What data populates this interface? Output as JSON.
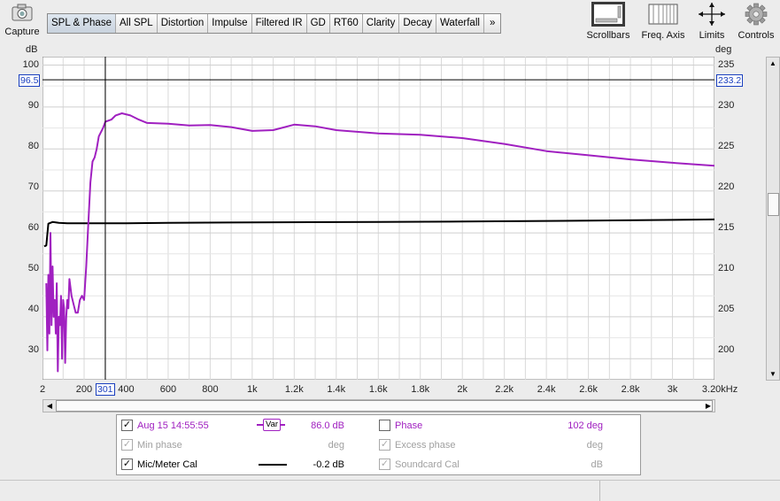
{
  "toolbar": {
    "capture_label": "Capture",
    "tabs": [
      "SPL & Phase",
      "All SPL",
      "Distortion",
      "Impulse",
      "Filtered IR",
      "GD",
      "RT60",
      "Clarity",
      "Decay",
      "Waterfall",
      "»"
    ],
    "active_tab": "SPL & Phase",
    "right_buttons": [
      {
        "label": "Scrollbars",
        "icon": "scrollbars-icon"
      },
      {
        "label": "Freq. Axis",
        "icon": "freq-axis-icon"
      },
      {
        "label": "Limits",
        "icon": "limits-icon"
      },
      {
        "label": "Controls",
        "icon": "gear-icon"
      }
    ]
  },
  "graph": {
    "left_unit": "dB",
    "right_unit": "deg",
    "left_ticks": [
      "100",
      "90",
      "80",
      "70",
      "60",
      "50",
      "40",
      "30"
    ],
    "right_ticks": [
      "235",
      "230",
      "225",
      "220",
      "215",
      "210",
      "205",
      "200"
    ],
    "x_ticks": [
      "2",
      "200",
      "400",
      "600",
      "800",
      "1k",
      "1.2k",
      "1.4k",
      "1.6k",
      "1.8k",
      "2k",
      "2.2k",
      "2.4k",
      "2.6k",
      "2.8k",
      "3k",
      "3.20kHz"
    ],
    "cursor": {
      "left_value": "96.5",
      "right_value": "233.2",
      "x_value": "301"
    }
  },
  "chart_data": {
    "type": "line",
    "x_unit": "Hz",
    "xlim": [
      2,
      3200
    ],
    "ylim_left": [
      25,
      102
    ],
    "ylim_right": [
      195,
      237
    ],
    "grid": true,
    "series": [
      {
        "name": "Aug 15 14:55:55",
        "color": "#a020c0",
        "axis": "left",
        "points": [
          [
            20,
            48
          ],
          [
            25,
            32
          ],
          [
            30,
            50
          ],
          [
            35,
            36
          ],
          [
            40,
            60
          ],
          [
            45,
            38
          ],
          [
            50,
            52
          ],
          [
            55,
            40
          ],
          [
            60,
            44
          ],
          [
            65,
            36
          ],
          [
            70,
            48
          ],
          [
            75,
            27
          ],
          [
            80,
            40
          ],
          [
            85,
            38
          ],
          [
            90,
            45
          ],
          [
            95,
            30
          ],
          [
            100,
            44
          ],
          [
            105,
            42
          ],
          [
            110,
            29
          ],
          [
            115,
            40
          ],
          [
            120,
            44
          ],
          [
            125,
            42
          ],
          [
            130,
            49
          ],
          [
            140,
            45
          ],
          [
            150,
            43
          ],
          [
            160,
            41
          ],
          [
            170,
            41
          ],
          [
            180,
            44
          ],
          [
            190,
            45
          ],
          [
            200,
            44
          ],
          [
            210,
            52
          ],
          [
            220,
            62
          ],
          [
            230,
            72
          ],
          [
            240,
            77
          ],
          [
            250,
            78
          ],
          [
            260,
            80
          ],
          [
            270,
            83
          ],
          [
            280,
            84
          ],
          [
            290,
            85
          ],
          [
            301,
            86.5
          ],
          [
            330,
            87
          ],
          [
            350,
            88
          ],
          [
            380,
            88.5
          ],
          [
            420,
            88
          ],
          [
            460,
            87
          ],
          [
            500,
            86.2
          ],
          [
            600,
            86
          ],
          [
            700,
            85.6
          ],
          [
            800,
            85.7
          ],
          [
            900,
            85.2
          ],
          [
            1000,
            84.3
          ],
          [
            1100,
            84.5
          ],
          [
            1200,
            85.8
          ],
          [
            1300,
            85.4
          ],
          [
            1400,
            84.5
          ],
          [
            1600,
            83.7
          ],
          [
            1800,
            83.4
          ],
          [
            2000,
            82.6
          ],
          [
            2200,
            81.2
          ],
          [
            2400,
            79.5
          ],
          [
            2600,
            78.5
          ],
          [
            2800,
            77.5
          ],
          [
            3000,
            76.7
          ],
          [
            3200,
            76
          ]
        ]
      },
      {
        "name": "Mic/Meter Cal",
        "color": "#000000",
        "axis": "left",
        "points": [
          [
            10,
            56.8
          ],
          [
            20,
            57
          ],
          [
            30,
            62.2
          ],
          [
            50,
            62.6
          ],
          [
            80,
            62.4
          ],
          [
            120,
            62.3
          ],
          [
            200,
            62.3
          ],
          [
            400,
            62.3
          ],
          [
            600,
            62.4
          ],
          [
            1000,
            62.5
          ],
          [
            1600,
            62.6
          ],
          [
            2000,
            62.7
          ],
          [
            2600,
            62.9
          ],
          [
            3200,
            63.2
          ]
        ]
      }
    ]
  },
  "legend": {
    "rows": [
      {
        "checked": true,
        "label": "Aug 15 14:55:55",
        "color": "#a020c0",
        "var": "Var",
        "value": "86.0 dB",
        "right_checked": false,
        "right_label": "Phase",
        "right_value": "102 deg",
        "right_color": "#a020c0",
        "disabled": false
      },
      {
        "checked": true,
        "label": "Min phase",
        "color": "#a0a0a0",
        "var": "",
        "value": "deg",
        "right_checked": true,
        "right_label": "Excess phase",
        "right_value": "deg",
        "right_color": "#a0a0a0",
        "disabled": true
      },
      {
        "checked": true,
        "label": "Mic/Meter Cal",
        "color": "#000000",
        "var": "",
        "value": "-0.2 dB",
        "right_checked": true,
        "right_label": "Soundcard Cal",
        "right_value": "dB",
        "right_color": "#a0a0a0",
        "disabled": false
      }
    ]
  }
}
